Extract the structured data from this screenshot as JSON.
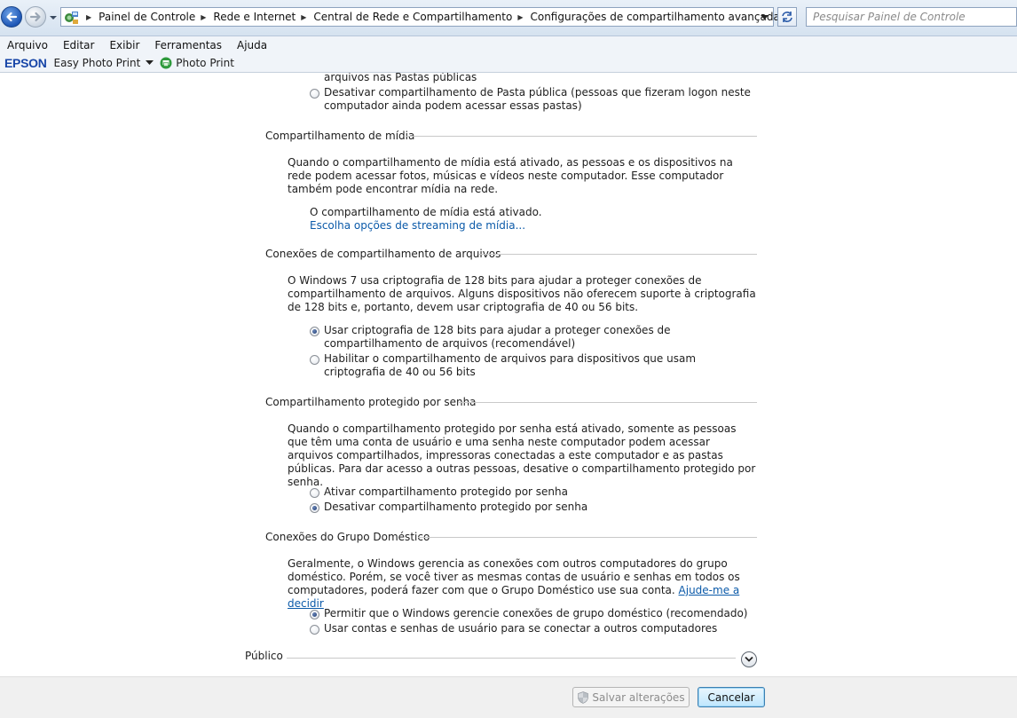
{
  "address": {
    "breadcrumbs": [
      "Painel de Controle",
      "Rede e Internet",
      "Central de Rede e Compartilhamento",
      "Configurações de compartilhamento avançadas"
    ],
    "search_placeholder": "Pesquisar Painel de Controle"
  },
  "menu": [
    "Arquivo",
    "Editar",
    "Exibir",
    "Ferramentas",
    "Ajuda"
  ],
  "toolbar": {
    "brand": "EPSON",
    "easy_photo_print": "Easy Photo Print",
    "photo_print": "Photo Print"
  },
  "public_folder": {
    "option_on_tail": "arquivos nas Pastas públicas",
    "option_off": "Desativar compartilhamento de Pasta pública (pessoas que fizeram logon neste computador ainda podem acessar essas pastas)"
  },
  "media": {
    "heading": "Compartilhamento de mídia",
    "description": "Quando o compartilhamento de mídia está ativado, as pessoas e os dispositivos na rede podem acessar fotos, músicas e vídeos neste computador. Esse computador também pode encontrar mídia na rede.",
    "status": "O compartilhamento de mídia está ativado.",
    "link": "Escolha opções de streaming de mídia..."
  },
  "file_sharing": {
    "heading": "Conexões de compartilhamento de arquivos",
    "description": "O Windows 7 usa criptografia de 128 bits para ajudar a proteger conexões de compartilhamento de arquivos. Alguns dispositivos não oferecem suporte à criptografia de 128 bits e, portanto, devem usar criptografia de 40 ou 56 bits.",
    "option_128": "Usar criptografia de 128 bits para ajudar a proteger conexões de compartilhamento de arquivos (recomendável)",
    "option_40_56": "Habilitar o compartilhamento de arquivos para dispositivos que usam criptografia de 40 ou 56 bits"
  },
  "password": {
    "heading": "Compartilhamento protegido por senha",
    "description": "Quando o compartilhamento protegido por senha está ativado, somente as pessoas que têm uma conta de usuário e uma senha neste computador podem acessar arquivos compartilhados, impressoras conectadas a este computador e as pastas públicas. Para dar acesso a outras pessoas, desative o compartilhamento protegido por senha.",
    "option_on": "Ativar compartilhamento protegido por senha",
    "option_off": "Desativar compartilhamento protegido por senha"
  },
  "homegroup": {
    "heading": "Conexões do Grupo Doméstico",
    "description": "Geralmente, o Windows gerencia as conexões com outros computadores do grupo doméstico. Porém, se você tiver as mesmas contas de usuário e senhas em todos os computadores, poderá fazer com que o Grupo Doméstico use sua conta.",
    "help_link": "Ajude-me a decidir",
    "option_windows": "Permitir que o Windows gerencie conexões de grupo doméstico (recomendado)",
    "option_accounts": "Usar contas e senhas de usuário para se conectar a outros computadores"
  },
  "public_profile": {
    "heading": "Público"
  },
  "footer": {
    "save": "Salvar alterações",
    "cancel": "Cancelar"
  },
  "icons": {
    "back": "back-arrow-icon",
    "forward": "forward-arrow-icon",
    "control_panel": "control-panel-icon",
    "refresh": "refresh-icon",
    "shield": "uac-shield-icon",
    "expand": "chevron-down-icon"
  },
  "selected": {
    "file_sharing": "option_128",
    "password": "option_off",
    "homegroup": "option_windows",
    "public_folder": "unset"
  }
}
